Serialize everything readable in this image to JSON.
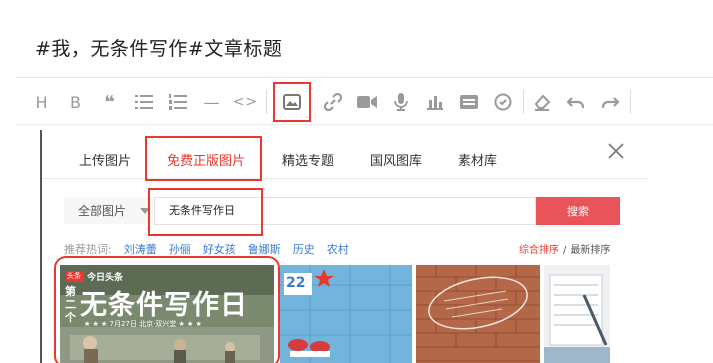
{
  "editor": {
    "title": "#我，无条件写作#文章标题"
  },
  "toolbar": {
    "buttons": [
      {
        "name": "heading",
        "label": "H"
      },
      {
        "name": "bold",
        "label": "B"
      },
      {
        "name": "quote",
        "label": "❝"
      },
      {
        "name": "unordered-list",
        "label": ""
      },
      {
        "name": "ordered-list",
        "label": ""
      },
      {
        "name": "divider",
        "label": "—"
      },
      {
        "name": "code",
        "label": "<>"
      }
    ],
    "media_buttons": [
      "image-icon",
      "link-icon",
      "video-icon",
      "audio-icon",
      "chart-icon",
      "card-icon",
      "mention-icon"
    ],
    "end_buttons": [
      "eraser-icon",
      "undo-icon",
      "redo-icon"
    ]
  },
  "dialog": {
    "tabs": [
      {
        "label": "上传图片"
      },
      {
        "label": "免费正版图片"
      },
      {
        "label": "精选专题"
      },
      {
        "label": "国风图库"
      },
      {
        "label": "素材库"
      }
    ],
    "filter_label": "全部图片",
    "search_value": "无条件写作日",
    "search_button": "搜索",
    "hot_label": "推荐热词:",
    "hot_keywords": [
      "刘涛蕾",
      "孙俪",
      "好女孩",
      "鲁娜斯",
      "历史",
      "农村"
    ],
    "sort_active": "综合排序",
    "sort_separator": "/",
    "sort_other": "最新排序",
    "thumb1": {
      "badge": "头条",
      "brand": "今日头条",
      "side_text": "第二个",
      "headline": "无条件写作日",
      "subline": "★ ★ ★ 7月27日 北京·双兴堂 ★ ★ ★"
    },
    "thumb2": {
      "number": "22"
    }
  },
  "colors": {
    "accent_red": "#e8382f",
    "search_button": "#e9545a",
    "link_blue": "#3a7bd5",
    "icon_gray": "#9a9a9a"
  }
}
